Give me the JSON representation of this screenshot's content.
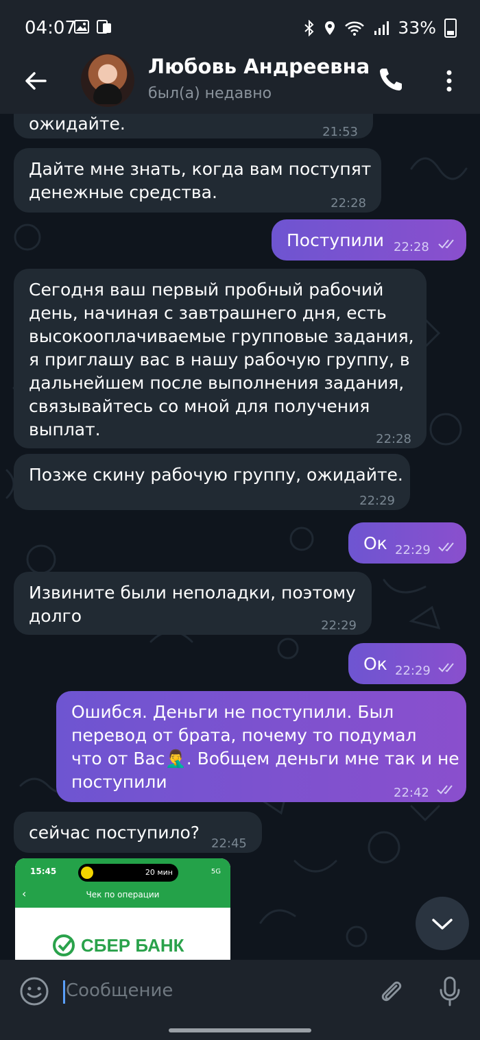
{
  "status_bar": {
    "time": "04:07",
    "battery": "33%"
  },
  "header": {
    "contact_name": "Любовь Андреевна",
    "contact_status": "был(а) недавно"
  },
  "messages": [
    {
      "direction": "in",
      "text_lines": [
        "ожидайте."
      ],
      "time": "21:53"
    },
    {
      "direction": "in",
      "text_lines": [
        "Дайте мне знать, когда вам поступят",
        "денежные средства."
      ],
      "time": "22:28"
    },
    {
      "direction": "out",
      "text_lines": [
        "Поступили"
      ],
      "time": "22:28",
      "read": true
    },
    {
      "direction": "in",
      "text_lines": [
        "Сегодня ваш первый пробный рабочий",
        "день, начиная с завтрашнего дня, есть",
        "высокооплачиваемые групповые задания,",
        "я приглашу вас в нашу рабочую группу, в",
        "дальнейшем после выполнения задания,",
        "связывайтесь со мной для получения",
        "выплат."
      ],
      "time": "22:28"
    },
    {
      "direction": "in",
      "text_lines": [
        "Позже скину рабочую группу, ожидайте."
      ],
      "time": "22:29"
    },
    {
      "direction": "out",
      "text_lines": [
        "Ок"
      ],
      "time": "22:29",
      "read": true
    },
    {
      "direction": "in",
      "text_lines": [
        "Извините были неполадки, поэтому",
        "долго"
      ],
      "time": "22:29"
    },
    {
      "direction": "out",
      "text_lines": [
        "Ок"
      ],
      "time": "22:29",
      "read": true
    },
    {
      "direction": "out",
      "text_lines": [
        "Ошибся. Деньги не поступили.  Был",
        "перевод от брата,  почему то подумал",
        "что от Вас🤦‍♂️. Вобщем деньги мне так и не",
        "поступили"
      ],
      "time": "22:42",
      "read": true
    },
    {
      "direction": "in",
      "text_lines": [
        "сейчас поступило?"
      ],
      "time": "22:45"
    }
  ],
  "photo": {
    "time": "15:45",
    "pill_text": "20 мин",
    "signal_text": "5G",
    "title": "Чек по операции",
    "bank_name": "СБЕР БАНК"
  },
  "input": {
    "placeholder": "Сообщение"
  },
  "colors": {
    "background": "#0f151d",
    "bar": "#1d232b",
    "incoming_bubble": "#212a33",
    "outgoing_bubble": "#7a52cf",
    "bank_green": "#2aa24b"
  }
}
